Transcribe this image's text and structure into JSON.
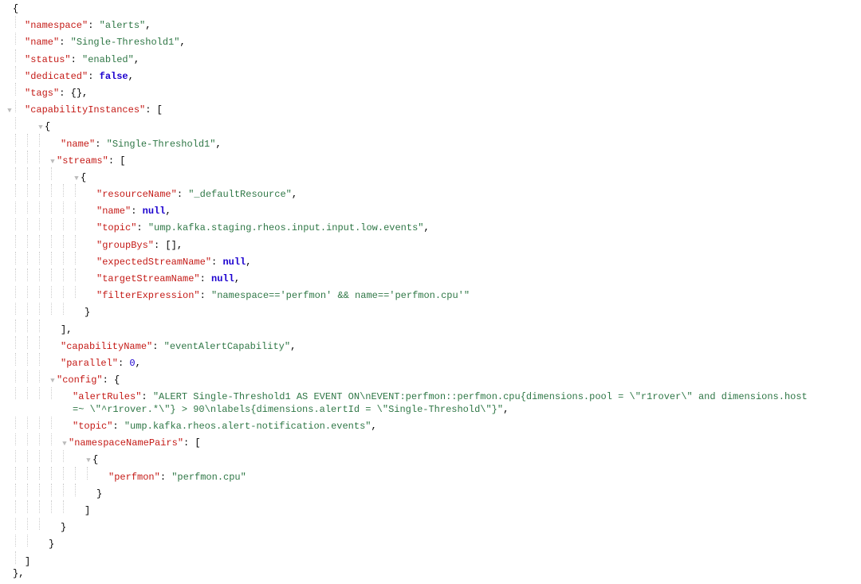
{
  "root": {
    "namespace_key": "\"namespace\"",
    "namespace_val": "\"alerts\"",
    "name_key": "\"name\"",
    "name_val": "\"Single-Threshold1\"",
    "status_key": "\"status\"",
    "status_val": "\"enabled\"",
    "dedicated_key": "\"dedicated\"",
    "dedicated_val": "false",
    "tags_key": "\"tags\"",
    "tags_val": "{}",
    "capInst_key": "\"capabilityInstances\"",
    "ci_name_key": "\"name\"",
    "ci_name_val": "\"Single-Threshold1\"",
    "streams_key": "\"streams\"",
    "resourceName_key": "\"resourceName\"",
    "resourceName_val": "\"_defaultResource\"",
    "stream_name_key": "\"name\"",
    "stream_name_val": "null",
    "topic_key": "\"topic\"",
    "topic_val": "\"ump.kafka.staging.rheos.input.input.low.events\"",
    "groupBys_key": "\"groupBys\"",
    "groupBys_val": "[]",
    "expectedStreamName_key": "\"expectedStreamName\"",
    "expectedStreamName_val": "null",
    "targetStreamName_key": "\"targetStreamName\"",
    "targetStreamName_val": "null",
    "filterExpression_key": "\"filterExpression\"",
    "filterExpression_val": "\"namespace=='perfmon' && name=='perfmon.cpu'\"",
    "capabilityName_key": "\"capabilityName\"",
    "capabilityName_val": "\"eventAlertCapability\"",
    "parallel_key": "\"parallel\"",
    "parallel_val": "0",
    "config_key": "\"config\"",
    "alertRules_key": "\"alertRules\"",
    "alertRules_val": "\"ALERT Single-Threshold1 AS EVENT ON\\nEVENT:perfmon::perfmon.cpu{dimensions.pool = \\\"r1rover\\\" and dimensions.host =~ \\\"^r1rover.*\\\"} > 90\\nlabels{dimensions.alertId = \\\"Single-Threshold\\\"}\"",
    "config_topic_key": "\"topic\"",
    "config_topic_val": "\"ump.kafka.rheos.alert-notification.events\"",
    "namespaceNamePairs_key": "\"namespaceNamePairs\"",
    "nnp_key": "\"perfmon\"",
    "nnp_val": "\"perfmon.cpu\""
  },
  "glyphs": {
    "arrow": "▼"
  }
}
